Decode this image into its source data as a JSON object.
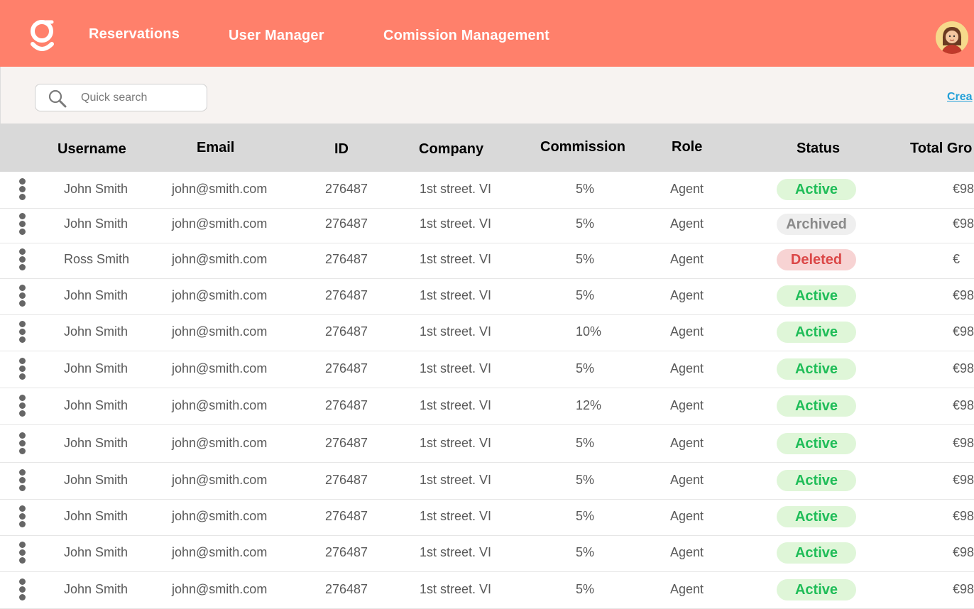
{
  "nav": {
    "items": [
      "Reservations",
      "User Manager",
      "Comission Management"
    ]
  },
  "search": {
    "placeholder": "Quick search"
  },
  "toolbar": {
    "create_label": "Crea"
  },
  "table": {
    "columns": [
      "Username",
      "Email",
      "ID",
      "Company",
      "Commission",
      "Role",
      "Status",
      "Total Gro"
    ],
    "rows": [
      {
        "username": "John Smith",
        "email": "john@smith.com",
        "id": "276487",
        "company": "1st street. VI",
        "commission": "5%",
        "role": "Agent",
        "status": "Active",
        "total": "€98"
      },
      {
        "username": "John Smith",
        "email": "john@smith.com",
        "id": "276487",
        "company": "1st street. VI",
        "commission": "5%",
        "role": "Agent",
        "status": "Archived",
        "total": "€98"
      },
      {
        "username": "Ross Smith",
        "email": "john@smith.com",
        "id": "276487",
        "company": "1st street. VI",
        "commission": "5%",
        "role": "Agent",
        "status": "Deleted",
        "total": "€"
      },
      {
        "username": "John Smith",
        "email": "john@smith.com",
        "id": "276487",
        "company": "1st street. VI",
        "commission": "5%",
        "role": "Agent",
        "status": "Active",
        "total": "€98"
      },
      {
        "username": "John Smith",
        "email": "john@smith.com",
        "id": "276487",
        "company": "1st street. VI",
        "commission": "10%",
        "role": "Agent",
        "status": "Active",
        "total": "€98"
      },
      {
        "username": "John Smith",
        "email": "john@smith.com",
        "id": "276487",
        "company": "1st street. VI",
        "commission": "5%",
        "role": "Agent",
        "status": "Active",
        "total": "€98"
      },
      {
        "username": "John Smith",
        "email": "john@smith.com",
        "id": "276487",
        "company": "1st street. VI",
        "commission": "12%",
        "role": "Agent",
        "status": "Active",
        "total": "€98"
      },
      {
        "username": "John Smith",
        "email": "john@smith.com",
        "id": "276487",
        "company": "1st street. VI",
        "commission": "5%",
        "role": "Agent",
        "status": "Active",
        "total": "€98"
      },
      {
        "username": "John Smith",
        "email": "john@smith.com",
        "id": "276487",
        "company": "1st street. VI",
        "commission": "5%",
        "role": "Agent",
        "status": "Active",
        "total": "€98"
      },
      {
        "username": "John Smith",
        "email": "john@smith.com",
        "id": "276487",
        "company": "1st street. VI",
        "commission": "5%",
        "role": "Agent",
        "status": "Active",
        "total": "€98"
      },
      {
        "username": "John Smith",
        "email": "john@smith.com",
        "id": "276487",
        "company": "1st street. VI",
        "commission": "5%",
        "role": "Agent",
        "status": "Active",
        "total": "€98"
      },
      {
        "username": "John Smith",
        "email": "john@smith.com",
        "id": "276487",
        "company": "1st street. VI",
        "commission": "5%",
        "role": "Agent",
        "status": "Active",
        "total": "€98"
      }
    ]
  },
  "colors": {
    "brand": "#ff806b",
    "active_text": "#1fbd58",
    "active_bg": "#dff6d8",
    "archived_text": "#8a8a8a",
    "archived_bg": "#efefef",
    "deleted_text": "#db4747",
    "deleted_bg": "#f7d3d3",
    "link": "#23a0d8"
  },
  "icons": {
    "logo": "brand-logo-icon",
    "search": "search-icon",
    "row_menu": "kebab-menu-icon",
    "avatar": "user-avatar"
  }
}
